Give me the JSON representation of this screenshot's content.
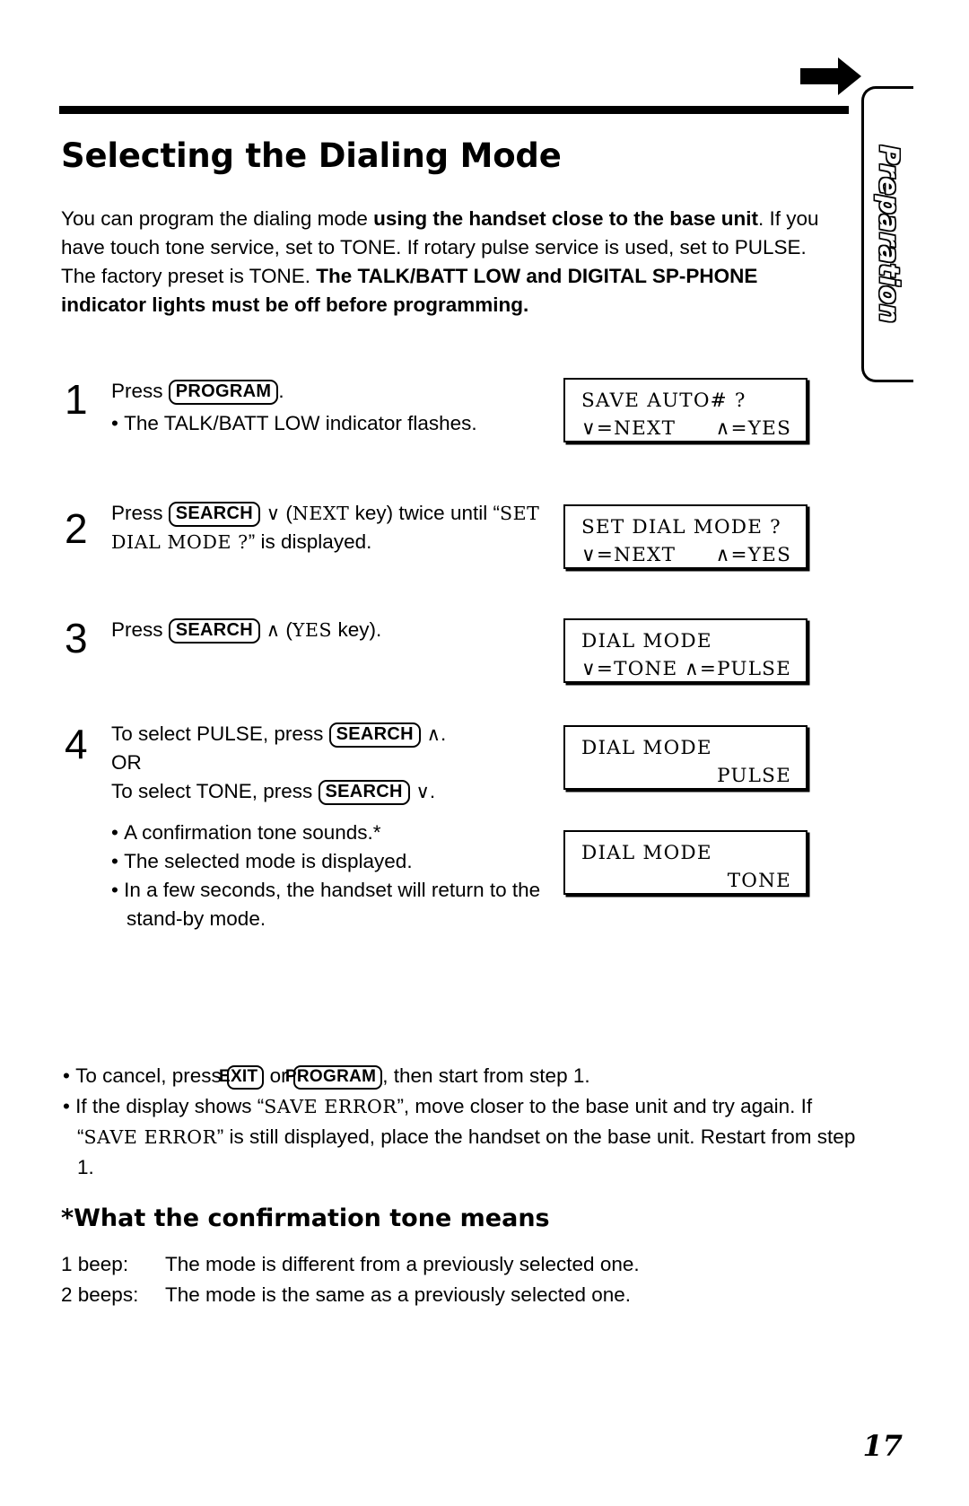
{
  "side_tab": {
    "label": "Preparation"
  },
  "header": {
    "title": "Selecting the Dialing Mode",
    "arrow_icon": "right-arrow-icon"
  },
  "intro": {
    "part1": "You can program the dialing mode ",
    "bold1": "using the handset close to the base unit",
    "part2": ". If you have touch tone service, set to TONE. If rotary pulse service is used, set to PULSE. The factory preset is TONE. ",
    "bold2": "The TALK/BATT LOW and DIGITAL SP-PHONE indicator lights must be off before programming."
  },
  "steps": [
    {
      "number": "1",
      "press_label": "Press ",
      "key": "PROGRAM",
      "after_key": ".",
      "bullets": [
        "The TALK/BATT LOW indicator flashes."
      ]
    },
    {
      "number": "2",
      "press_label": "Press ",
      "key": "SEARCH",
      "arrow": "∨",
      "mid": " (",
      "mono_key": "NEXT",
      "after": " key) twice until “",
      "mono_display": "SET DIAL MODE ?",
      "tail": "” is displayed."
    },
    {
      "number": "3",
      "press_label": "Press ",
      "key": "SEARCH",
      "arrow": "∧",
      "mid": " (",
      "mono_key": "YES",
      "after": " key)."
    },
    {
      "number": "4",
      "line1_pre": "To select PULSE, press ",
      "line1_key": "SEARCH",
      "line1_arrow": "∧",
      "line1_post": ".",
      "or_label": "OR",
      "line2_pre": "To select TONE, press ",
      "line2_key": "SEARCH",
      "line2_arrow": "∨",
      "line2_post": ".",
      "bullets": [
        "A confirmation tone sounds.*",
        "The selected mode is displayed.",
        "In a few seconds, the handset will return to the stand-by mode."
      ]
    }
  ],
  "displays": [
    {
      "line1_left": "SAVE AUTO# ?",
      "line1_right": "",
      "line2_left": "∨=NEXT",
      "line2_right": "∧=YES"
    },
    {
      "line1_left": "SET DIAL MODE ?",
      "line1_right": "",
      "line2_left": "∨=NEXT",
      "line2_right": "∧=YES"
    },
    {
      "line1_left": "DIAL MODE",
      "line1_right": "",
      "line2_left": "∨=TONE",
      "line2_right": "∧=PULSE"
    },
    {
      "line1_left": "DIAL MODE",
      "line1_right": "",
      "line2_left": "",
      "line2_right": "PULSE"
    },
    {
      "line1_left": "DIAL MODE",
      "line1_right": "",
      "line2_left": "",
      "line2_right": "TONE"
    }
  ],
  "notes": {
    "note1_pre": "To cancel, press ",
    "note1_key1": "EXIT",
    "note1_mid": " or ",
    "note1_key2": "PROGRAM",
    "note1_post": ", then start from step 1.",
    "note2_pre": "If the display shows “",
    "note2_mono1": "SAVE ERROR",
    "note2_mid": "”, move closer to the base unit and try again. If “",
    "note2_mono2": "SAVE ERROR",
    "note2_post": "” is still displayed, place the handset on the base unit. Restart from step 1."
  },
  "confirmation": {
    "heading": "*What the confirmation tone means",
    "rows": [
      {
        "label": "1 beep:",
        "text": "The mode is different from a previously selected one."
      },
      {
        "label": "2 beeps:",
        "text": "The mode is the same as a previously selected one."
      }
    ]
  },
  "page_number": "17"
}
